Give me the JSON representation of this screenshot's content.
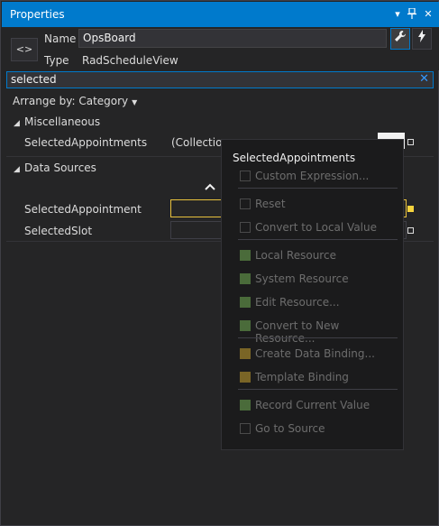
{
  "window": {
    "title": "Properties",
    "btn_dropdown": "▾",
    "btn_pin": "⊕",
    "btn_close": "✕"
  },
  "header": {
    "code_icon": "<>",
    "name_label": "Name",
    "name_value": "OpsBoard",
    "type_label": "Type",
    "type_value": "RadScheduleView",
    "properties_button": "wrench-icon",
    "events_button": "lightning-icon"
  },
  "search": {
    "value": "selected",
    "clear": "✕"
  },
  "arrange": {
    "label": "Arrange by: Category",
    "caret": "▼"
  },
  "categories": [
    {
      "name": "Miscellaneous",
      "properties": [
        {
          "label": "SelectedAppointments",
          "value": "(Collection"
        }
      ]
    },
    {
      "name": "Data Sources",
      "properties": [
        {
          "label": "SelectedAppointment",
          "value": ""
        },
        {
          "label": "SelectedSlot",
          "value": ""
        }
      ]
    }
  ],
  "context_menu": {
    "title": "SelectedAppointments",
    "items": [
      {
        "label": "Custom Expression...",
        "icon": "empty"
      },
      {
        "label": "Reset",
        "icon": "empty"
      },
      {
        "label": "Convert to Local Value",
        "icon": "empty"
      },
      {
        "label": "Local Resource",
        "icon": "green"
      },
      {
        "label": "System Resource",
        "icon": "green"
      },
      {
        "label": "Edit Resource...",
        "icon": "green"
      },
      {
        "label": "Convert to New Resource...",
        "icon": "green"
      },
      {
        "label": "Create Data Binding...",
        "icon": "gold"
      },
      {
        "label": "Template Binding",
        "icon": "gold"
      },
      {
        "label": "Record Current Value",
        "icon": "green"
      },
      {
        "label": "Go to Source",
        "icon": "empty"
      }
    ]
  },
  "colors": {
    "accent": "#007acc",
    "focus": "#e8c13d",
    "background": "#252526"
  }
}
